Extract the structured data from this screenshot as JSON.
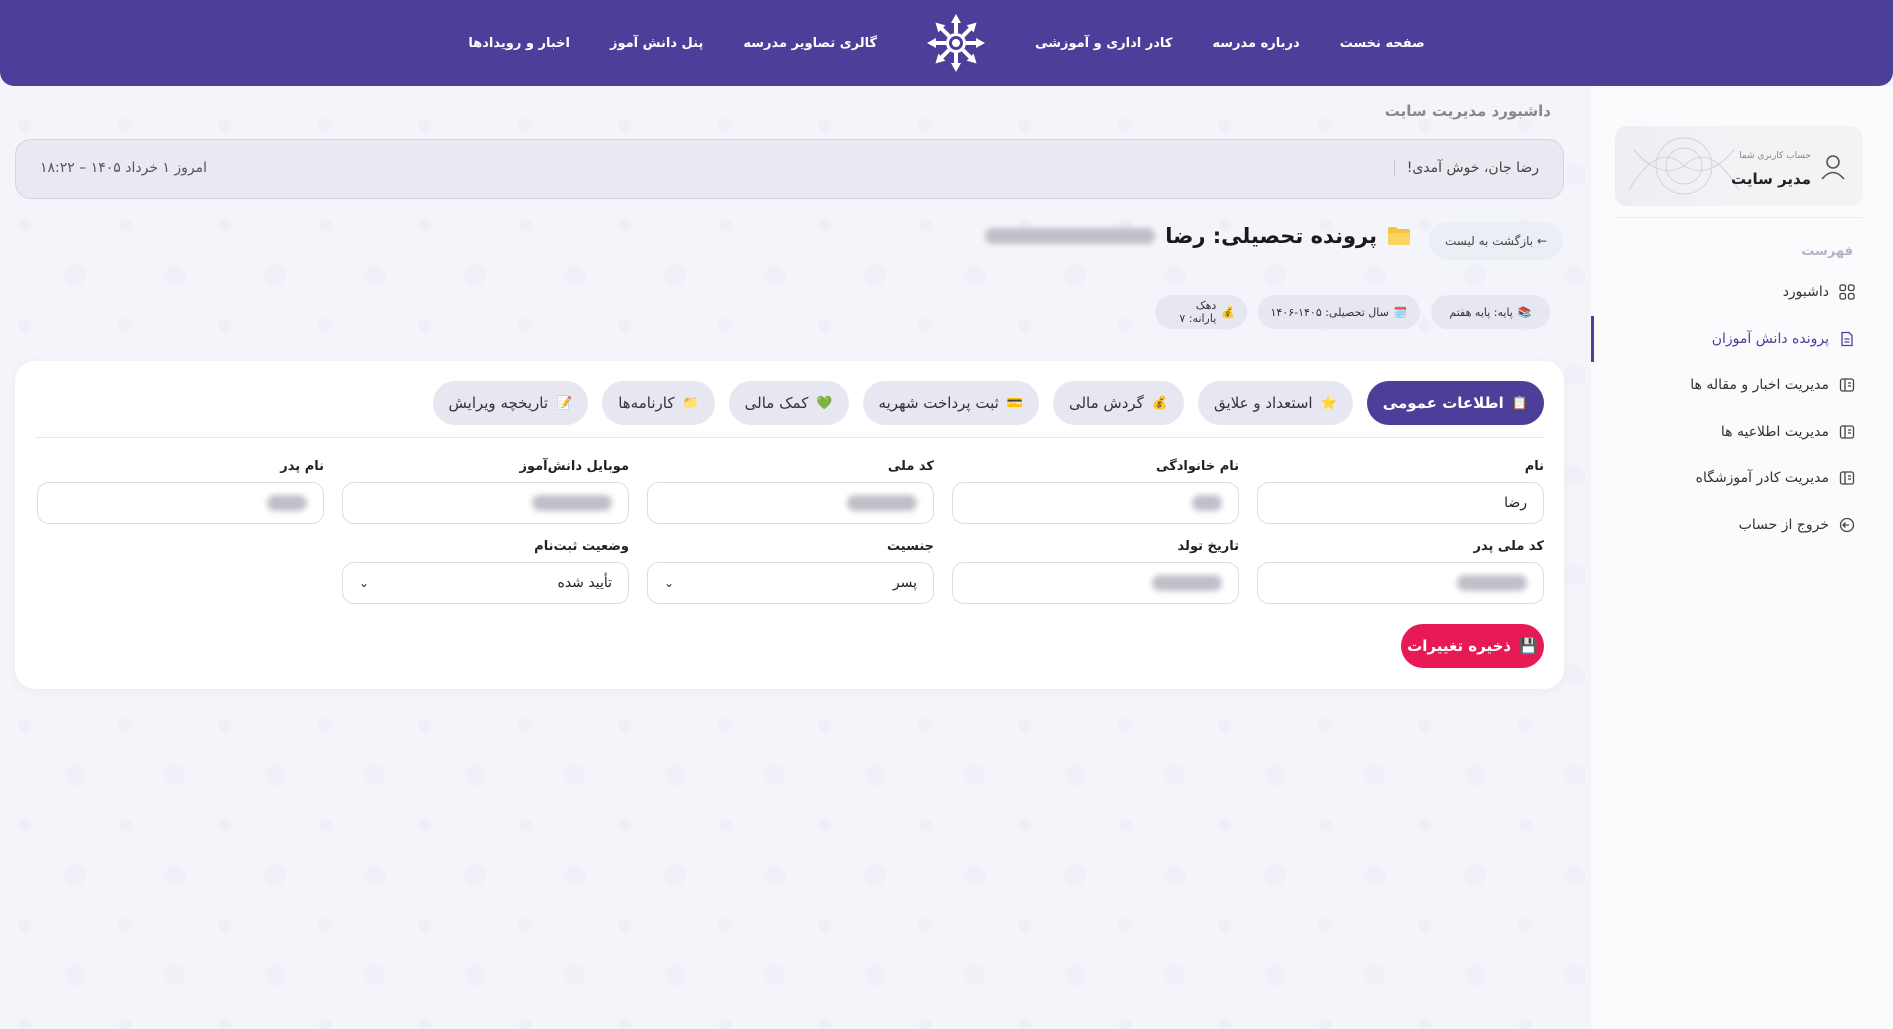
{
  "nav": {
    "items_right": [
      "صفحه نخست",
      "درباره مدرسه",
      "کادر اداری و آموزشی"
    ],
    "items_left": [
      "گالری تصاویر مدرسه",
      "پنل دانش آموز",
      "اخبار و رویدادها"
    ]
  },
  "sidebar": {
    "account_label": "حساب کاربری شما",
    "account_name": "مدیر سایت",
    "menu_title": "فهرست",
    "items": [
      {
        "label": "داشبورد",
        "icon": "grid-icon"
      },
      {
        "label": "پرونده دانش آموزان",
        "icon": "file-icon",
        "active": true
      },
      {
        "label": "مدیریت اخبار و مقاله ها",
        "icon": "book-icon"
      },
      {
        "label": "مدیریت اطلاعیه ها",
        "icon": "book-icon"
      },
      {
        "label": "مدیریت کادر آموزشگاه",
        "icon": "book-icon"
      },
      {
        "label": "خروج از حساب",
        "icon": "logout-icon"
      }
    ]
  },
  "main": {
    "page_title": "داشبورد مدیریت سایت",
    "welcome": "رضا جان، خوش آمدی!",
    "date": "امروز ۱ خرداد ۱۴۰۵ – ۱۸:۲۲",
    "back": "← بازگشت به لیست",
    "file_title": "پرونده تحصیلی: رضا",
    "chips": [
      {
        "icon": "📚",
        "text": "پایه: پایه هفتم"
      },
      {
        "icon": "🗓️",
        "text": "سال تحصیلی: ۱۴۰۵-۱۴۰۶"
      },
      {
        "icon": "💰",
        "text": "دهک یارانه: ۷"
      }
    ]
  },
  "tabs": [
    {
      "icon": "📋",
      "label": "اطلاعات عمومی",
      "active": true
    },
    {
      "icon": "⭐",
      "label": "استعداد و علایق"
    },
    {
      "icon": "💰",
      "label": "گردش مالی"
    },
    {
      "icon": "💳",
      "label": "ثبت پرداخت شهریه"
    },
    {
      "icon": "💚",
      "label": "کمک مالی"
    },
    {
      "icon": "📁",
      "label": "کارنامه‌ها"
    },
    {
      "icon": "📝",
      "label": "تاریخچه ویرایش"
    }
  ],
  "form": {
    "first_name": {
      "label": "نام",
      "value": "رضا"
    },
    "last_name": {
      "label": "نام خانوادگی"
    },
    "national_id": {
      "label": "کد ملی"
    },
    "mobile": {
      "label": "موبایل دانش‌آموز"
    },
    "father_name": {
      "label": "نام پدر"
    },
    "father_national_id": {
      "label": "کد ملی پدر"
    },
    "birth_date": {
      "label": "تاریخ تولد"
    },
    "gender": {
      "label": "جنسیت",
      "value": "پسر"
    },
    "registration_status": {
      "label": "وضعیت ثبت‌نام",
      "value": "تأیید شده"
    },
    "save": "ذخیره تغییرات",
    "save_icon": "💾"
  },
  "colors": {
    "primary": "#4b3f9a",
    "accent": "#e81a55"
  }
}
